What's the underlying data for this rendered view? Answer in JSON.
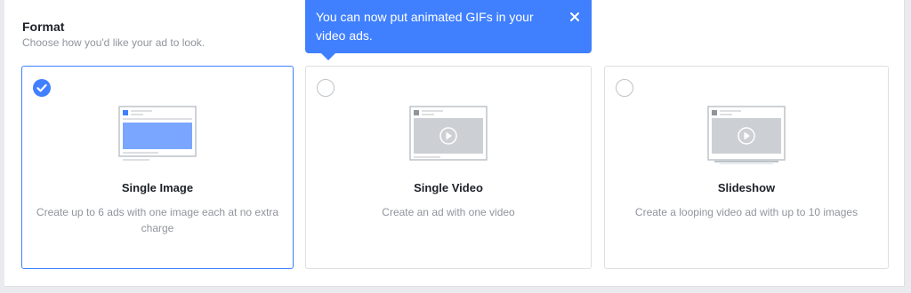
{
  "format": {
    "title": "Format",
    "subtitle": "Choose how you'd like your ad to look."
  },
  "tooltip": {
    "text": "You can now put animated GIFs in your video ads.",
    "close_icon": "close-icon"
  },
  "options": [
    {
      "title": "Single Image",
      "description": "Create up to 6 ads with one image each at no extra charge",
      "selected": true,
      "icon": "single-image-thumbnail-icon"
    },
    {
      "title": "Single Video",
      "description": "Create an ad with one video",
      "selected": false,
      "icon": "single-video-thumbnail-icon"
    },
    {
      "title": "Slideshow",
      "description": "Create a looping video ad with up to 10 images",
      "selected": false,
      "icon": "slideshow-thumbnail-icon"
    }
  ],
  "colors": {
    "accent": "#4080ff",
    "border": "#dddfe2",
    "text_primary": "#1d2129",
    "text_secondary": "#90949c"
  }
}
